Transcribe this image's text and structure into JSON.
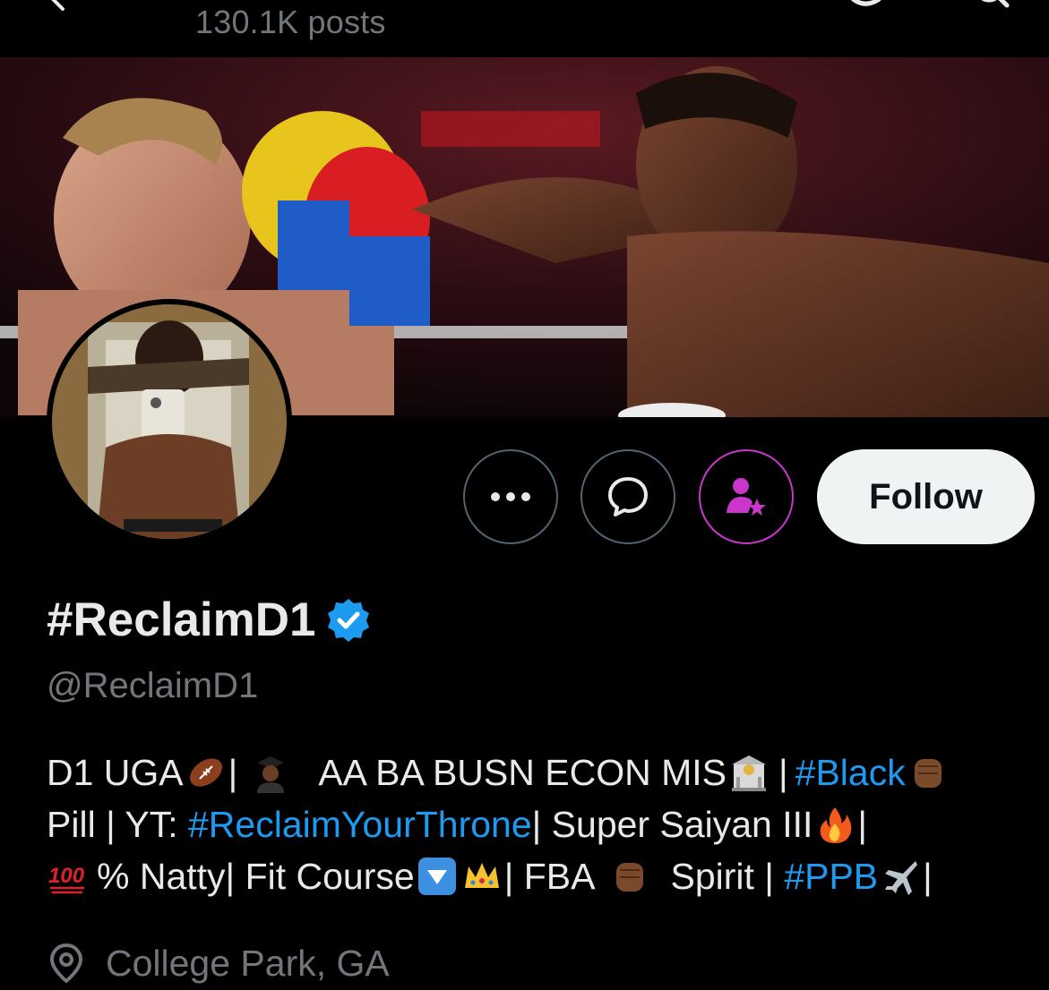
{
  "header": {
    "posts_count": "130.1K posts"
  },
  "profile": {
    "display_name": "#ReclaimD1",
    "handle": "@ReclaimD1",
    "verified": true,
    "follow_label": "Follow",
    "location": "College Park, GA"
  },
  "bio": {
    "line1": {
      "a": "D1 UGA",
      "b": "|",
      "c": "AA BA BUSN ECON MIS",
      "d": "|",
      "e": "#Black"
    },
    "line2": {
      "a": "Pill | YT: ",
      "b": "#ReclaimYourThrone",
      "c": "| Super Saiyan III",
      "d": "|"
    },
    "line3": {
      "a": "% Natty| Fit Course",
      "b": "| FBA",
      "c": "Spirit | ",
      "d": "#PPB",
      "e": "|"
    }
  },
  "icons": {
    "back": "back-arrow-icon",
    "more": "more-icon",
    "message": "message-icon",
    "subscribe": "subscribe-icon",
    "verified": "verified-badge-icon",
    "location": "location-pin-icon"
  },
  "colors": {
    "background": "#000000",
    "text_primary": "#e7e9ea",
    "text_secondary": "#71767b",
    "link": "#1d9bf0",
    "follow_bg": "#eff3f4",
    "subscribe_accent": "#c936c9"
  }
}
